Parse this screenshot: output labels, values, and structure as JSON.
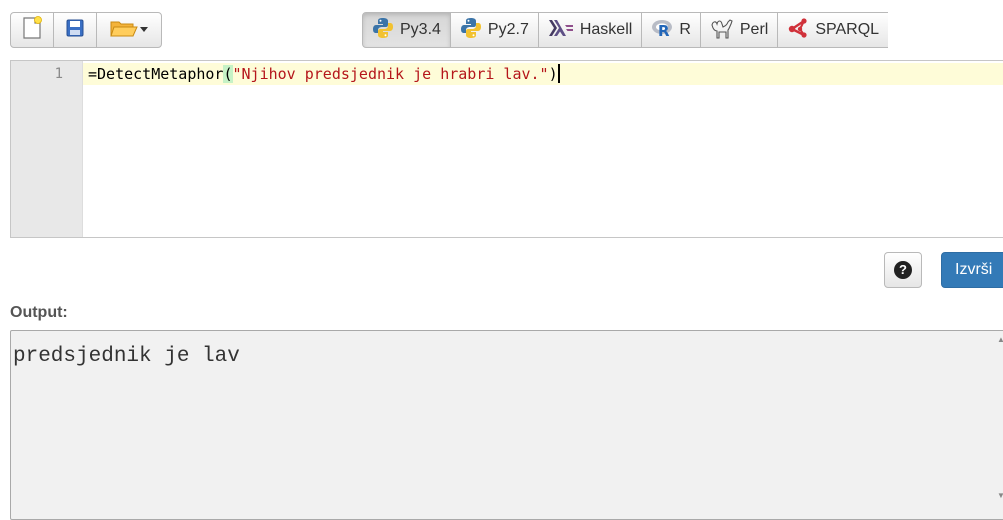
{
  "toolbar": {
    "file_buttons": [
      {
        "name": "new-file-icon"
      },
      {
        "name": "save-icon"
      },
      {
        "name": "open-folder-icon",
        "dropdown": "chevron-down-icon"
      }
    ],
    "languages": [
      {
        "label": "Py3.4",
        "icon": "python-icon",
        "active": true
      },
      {
        "label": "Py2.7",
        "icon": "python-icon",
        "active": false
      },
      {
        "label": "Haskell",
        "icon": "haskell-icon",
        "active": false
      },
      {
        "label": "R",
        "icon": "r-icon",
        "active": false
      },
      {
        "label": "Perl",
        "icon": "camel-icon",
        "active": false
      },
      {
        "label": "SPARQL",
        "icon": "sparql-icon",
        "active": false
      }
    ]
  },
  "editor": {
    "line_number": "1",
    "code": {
      "prefix": "=DetectMetaphor",
      "open_paren": "(",
      "string": "\"Njihov predsjednik je hrabri lav.\"",
      "close_paren": ")"
    }
  },
  "actions": {
    "help_symbol": "?",
    "run_label": "Izvrši"
  },
  "output": {
    "label": "Output:",
    "text": "predsjednik je lav"
  },
  "colors": {
    "accent": "#337ab7",
    "active_line": "#fefcd8",
    "string": "#b5161b",
    "gutter": "#e8e8e8",
    "output_bg": "#f1f1f1"
  }
}
